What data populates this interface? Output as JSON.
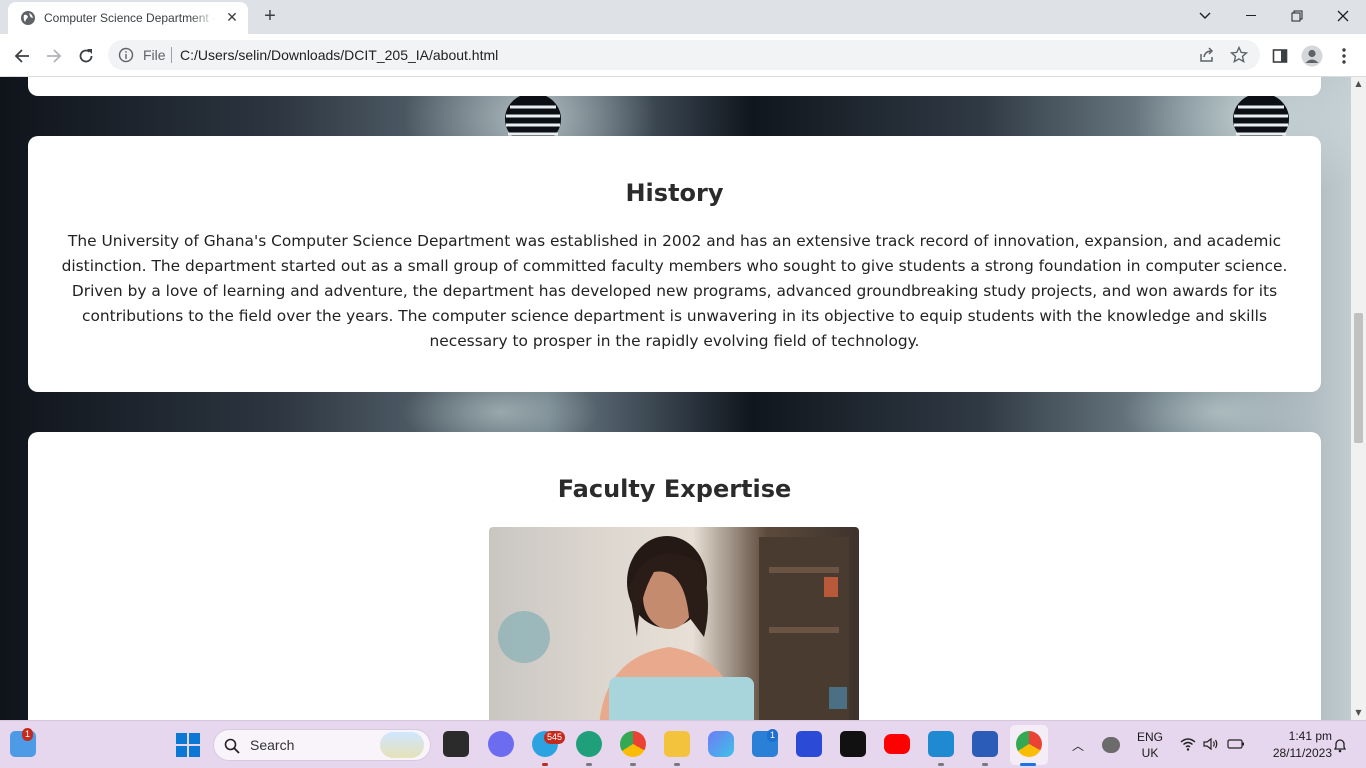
{
  "browser": {
    "tab_title": "Computer Science Department - ",
    "omnibox_scheme": "File",
    "url": "C:/Users/selin/Downloads/DCIT_205_IA/about.html"
  },
  "page": {
    "history": {
      "title": "History",
      "text": "The University of Ghana's Computer Science Department was established in 2002 and has an extensive track record of innovation, expansion, and academic distinction. The department started out as a small group of committed faculty members who sought to give students a strong foundation in computer science. Driven by a love of learning and adventure, the department has developed new programs, advanced groundbreaking study projects, and won awards for its contributions to the field over the years. The computer science department is unwavering in its objective to equip students with the knowledge and skills necessary to prosper in the rapidly evolving field of technology."
    },
    "faculty": {
      "title": "Faculty Expertise"
    }
  },
  "taskbar": {
    "search_label": "Search",
    "widgets_badge": "1",
    "telegram_badge": "545",
    "mail_badge": "1",
    "language_top": "ENG",
    "language_bottom": "UK",
    "time": "1:41 pm",
    "date": "28/11/2023"
  },
  "colors": {
    "tab_strip": "#dee1e6",
    "taskbar": "#e6d7ee",
    "card": "#ffffff",
    "heading": "#2b2b2b"
  }
}
